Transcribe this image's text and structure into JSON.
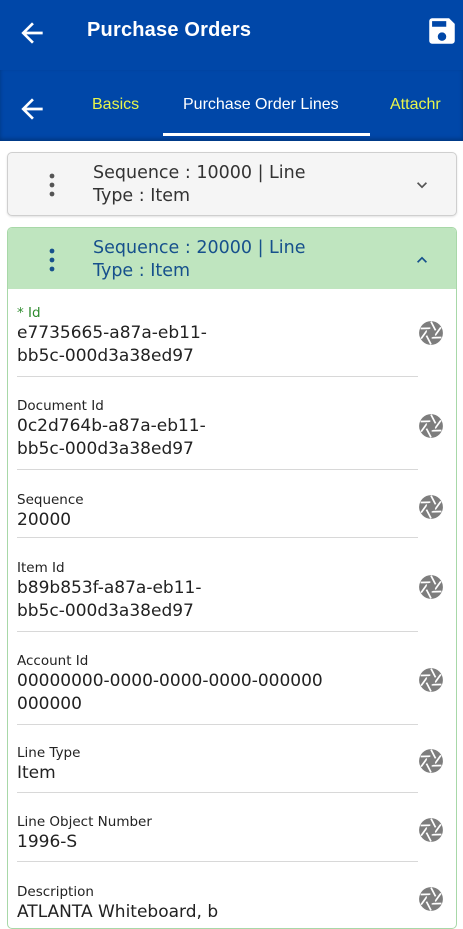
{
  "header": {
    "title": "Purchase Orders"
  },
  "tabs": {
    "basics": "Basics",
    "lines": "Purchase Order Lines",
    "attachments": "Attachr"
  },
  "lines": [
    {
      "line1": "Sequence  : 10000 | Line",
      "line2": "Type  : Item"
    },
    {
      "line1": "Sequence  : 20000 | Line",
      "line2": "Type  : Item"
    }
  ],
  "fields": [
    {
      "label": "* Id",
      "value_l1": "e7735665-a87a-eb11-",
      "value_l2": "bb5c-000d3a38ed97"
    },
    {
      "label": "Document Id",
      "value_l1": "0c2d764b-a87a-eb11-",
      "value_l2": "bb5c-000d3a38ed97"
    },
    {
      "label": "Sequence",
      "value_l1": "20000"
    },
    {
      "label": "Item Id",
      "value_l1": "b89b853f-a87a-eb11-",
      "value_l2": "bb5c-000d3a38ed97"
    },
    {
      "label": "Account Id",
      "value_l1": "00000000-0000-0000-0000-000000",
      "value_l2": "000000"
    },
    {
      "label": "Line Type",
      "value_l1": "Item"
    },
    {
      "label": "Line Object Number",
      "value_l1": "1996-S"
    },
    {
      "label": "Description",
      "value_l1": "ATLANTA Whiteboard, b"
    }
  ],
  "colors": {
    "appbar": "#0047a8",
    "tab_accent": "#e8f54c",
    "expanded_header": "#bfe5bf",
    "required_label": "#2e8b2e"
  },
  "icons": {
    "back": "arrow-left-icon",
    "save": "floppy-disk-icon",
    "more": "more-vertical-icon",
    "expand": "chevron-down-icon",
    "collapse": "chevron-up-icon",
    "field_action": "camera-aperture-icon"
  }
}
